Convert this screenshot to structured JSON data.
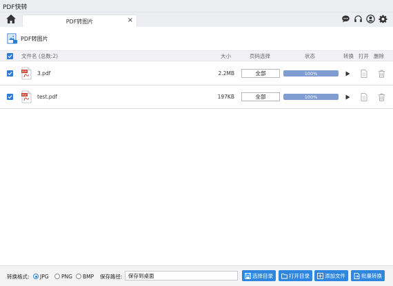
{
  "app": {
    "title": "PDF快转"
  },
  "tabs": [
    {
      "label": "PDF转图片",
      "close": "×"
    }
  ],
  "section": {
    "title": "PDF转图片"
  },
  "table": {
    "headers": {
      "filename": "文件名 (总数:2)",
      "size": "大小",
      "page_select": "页码选择",
      "status": "状态",
      "convert": "转换",
      "open": "打开",
      "delete": "删除"
    },
    "rows": [
      {
        "checked": true,
        "name": "3.pdf",
        "size": "2.2MB",
        "pages": "全部",
        "progress": 1.0,
        "progress_text": "100%"
      },
      {
        "checked": true,
        "name": "test.pdf",
        "size": "197KB",
        "pages": "全部",
        "progress": 1.0,
        "progress_text": "100%"
      }
    ]
  },
  "footer": {
    "format_label": "转换格式:",
    "formats": [
      {
        "label": "JPG",
        "checked": true
      },
      {
        "label": "PNG",
        "checked": false
      },
      {
        "label": "BMP",
        "checked": false
      }
    ],
    "path_label": "保存路径:",
    "path_value": "保存到桌面",
    "buttons": {
      "choose_dir": "选择目录",
      "open_dir": "打开目录",
      "add_file": "添加文件",
      "batch_convert": "批量转换"
    }
  },
  "colors": {
    "accent": "#2e86de",
    "checkbox": "#2e7cd6",
    "progress_fill": "#7f9dd0",
    "pdf_red": "#d23b2f"
  },
  "icons": [
    "home-icon",
    "chat-icon",
    "headset-icon",
    "user-icon",
    "gear-icon",
    "image-icon",
    "pdf-file-icon",
    "play-icon",
    "file-icon",
    "trash-icon",
    "save-icon",
    "folder-icon",
    "plus-icon",
    "convert-icon"
  ]
}
